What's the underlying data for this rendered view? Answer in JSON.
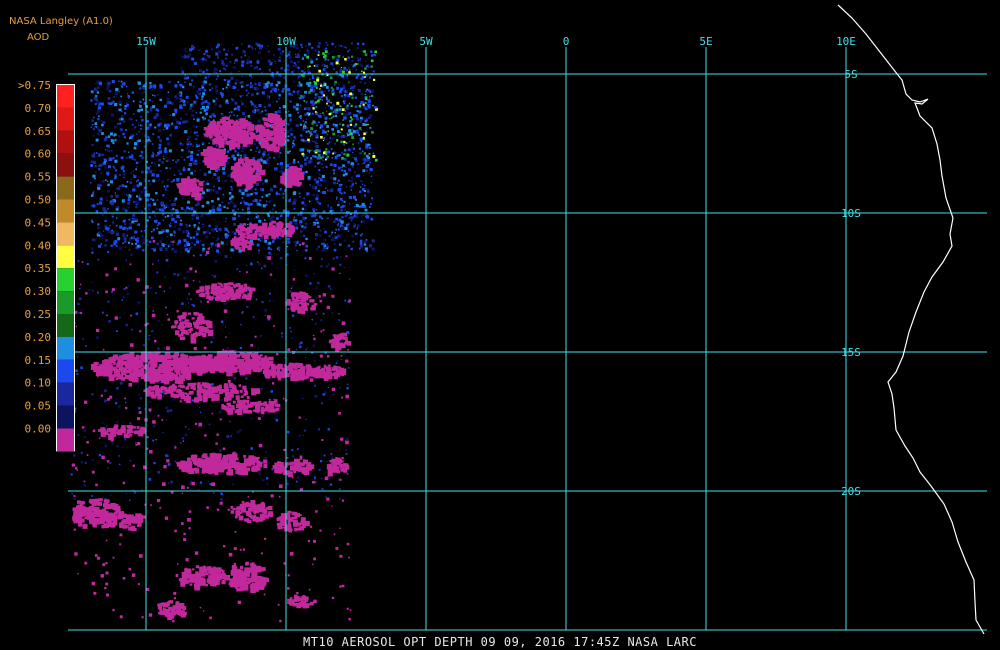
{
  "header": {
    "source": "NASA Langley (A1.0)",
    "product": "AOD"
  },
  "footer": {
    "caption": "MT10  AEROSOL OPT DEPTH   09 09, 2016 17:45Z   NASA LARC"
  },
  "colors": {
    "background": "#000000",
    "grid": "#40e0e8",
    "grid_label": "#40e0e8",
    "legend_label": "#e8a040",
    "coastline": "#ffffff",
    "low_aod": "#c0289c"
  },
  "legend": {
    "title": "AOD",
    "entries": [
      {
        "label": ">0.75",
        "color": "#ff2020"
      },
      {
        "label": "0.70",
        "color": "#e01818"
      },
      {
        "label": "0.65",
        "color": "#b01010"
      },
      {
        "label": "0.60",
        "color": "#8c1010"
      },
      {
        "label": "0.55",
        "color": "#8a6a18"
      },
      {
        "label": "0.50",
        "color": "#c08a28"
      },
      {
        "label": "0.45",
        "color": "#f0b860"
      },
      {
        "label": "0.40",
        "color": "#ffff40"
      },
      {
        "label": "0.35",
        "color": "#28d030"
      },
      {
        "label": "0.30",
        "color": "#1a9a28"
      },
      {
        "label": "0.25",
        "color": "#146818"
      },
      {
        "label": "0.20",
        "color": "#1e8ee0"
      },
      {
        "label": "0.15",
        "color": "#1c48f0"
      },
      {
        "label": "0.10",
        "color": "#1a28a0"
      },
      {
        "label": "0.05",
        "color": "#0c1460"
      },
      {
        "label": "0.00",
        "color": "#c0289c"
      }
    ]
  },
  "grid": {
    "longitudes": [
      {
        "value": -15,
        "label": "15W"
      },
      {
        "value": -10,
        "label": "10W"
      },
      {
        "value": -5,
        "label": "5W"
      },
      {
        "value": 0,
        "label": "0"
      },
      {
        "value": 5,
        "label": "5E"
      },
      {
        "value": 10,
        "label": "10E"
      }
    ],
    "latitudes": [
      {
        "value": -5,
        "label": "5S"
      },
      {
        "value": -10,
        "label": "10S"
      },
      {
        "value": -15,
        "label": "15S"
      },
      {
        "value": -20,
        "label": "20S"
      }
    ]
  }
}
